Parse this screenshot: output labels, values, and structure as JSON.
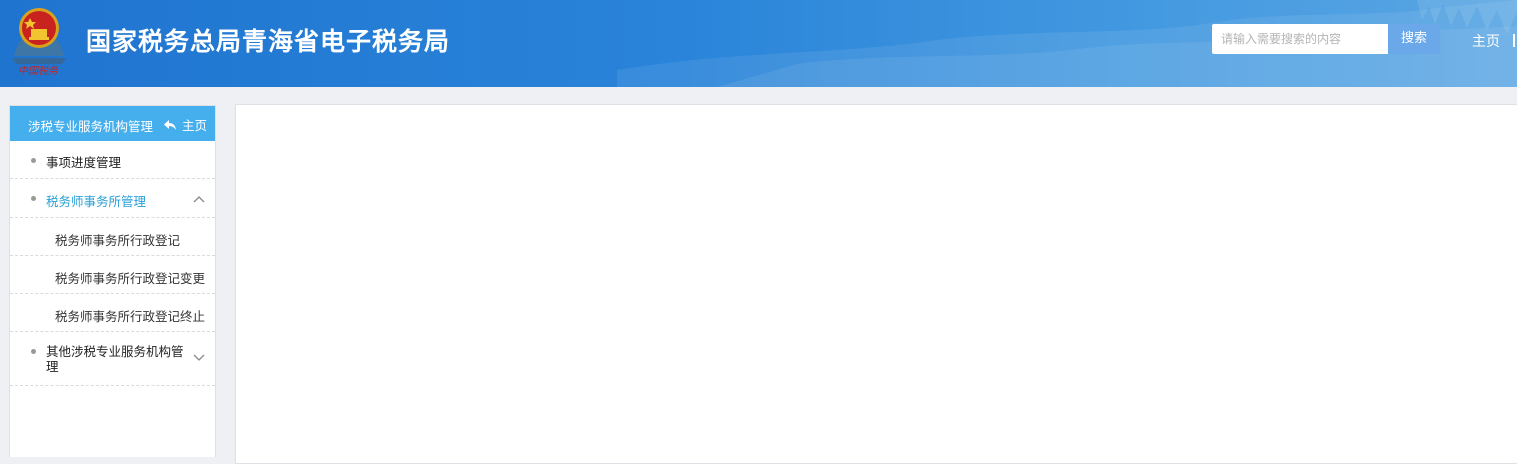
{
  "header": {
    "logo_text": "中国税务",
    "title": "国家税务总局青海省电子税务局",
    "search": {
      "placeholder": "请输入需要搜索的内容",
      "value": "",
      "button_label": "搜索"
    },
    "home_label": "主页"
  },
  "sidebar": {
    "title": "涉税专业服务机构管理",
    "home_label": "主页",
    "items": [
      {
        "label": "事项进度管理",
        "expanded": false
      },
      {
        "label": "税务师事务所管理",
        "expanded": true,
        "children": [
          {
            "label": "税务师事务所行政登记"
          },
          {
            "label": "税务师事务所行政登记变更"
          },
          {
            "label": "税务师事务所行政登记终止"
          }
        ]
      },
      {
        "label": "其他涉税专业服务机构管理",
        "expanded": false
      }
    ]
  },
  "colors": {
    "header_blue": "#1f74cf",
    "sidebar_header": "#45aeed",
    "active_text": "#2a9fd6",
    "search_button": "#6aa8ea"
  },
  "icons": {
    "emblem": "national-emblem-icon",
    "back": "reply-arrow-icon",
    "expanded": "chevron-up-icon",
    "collapsed": "chevron-down-icon"
  }
}
